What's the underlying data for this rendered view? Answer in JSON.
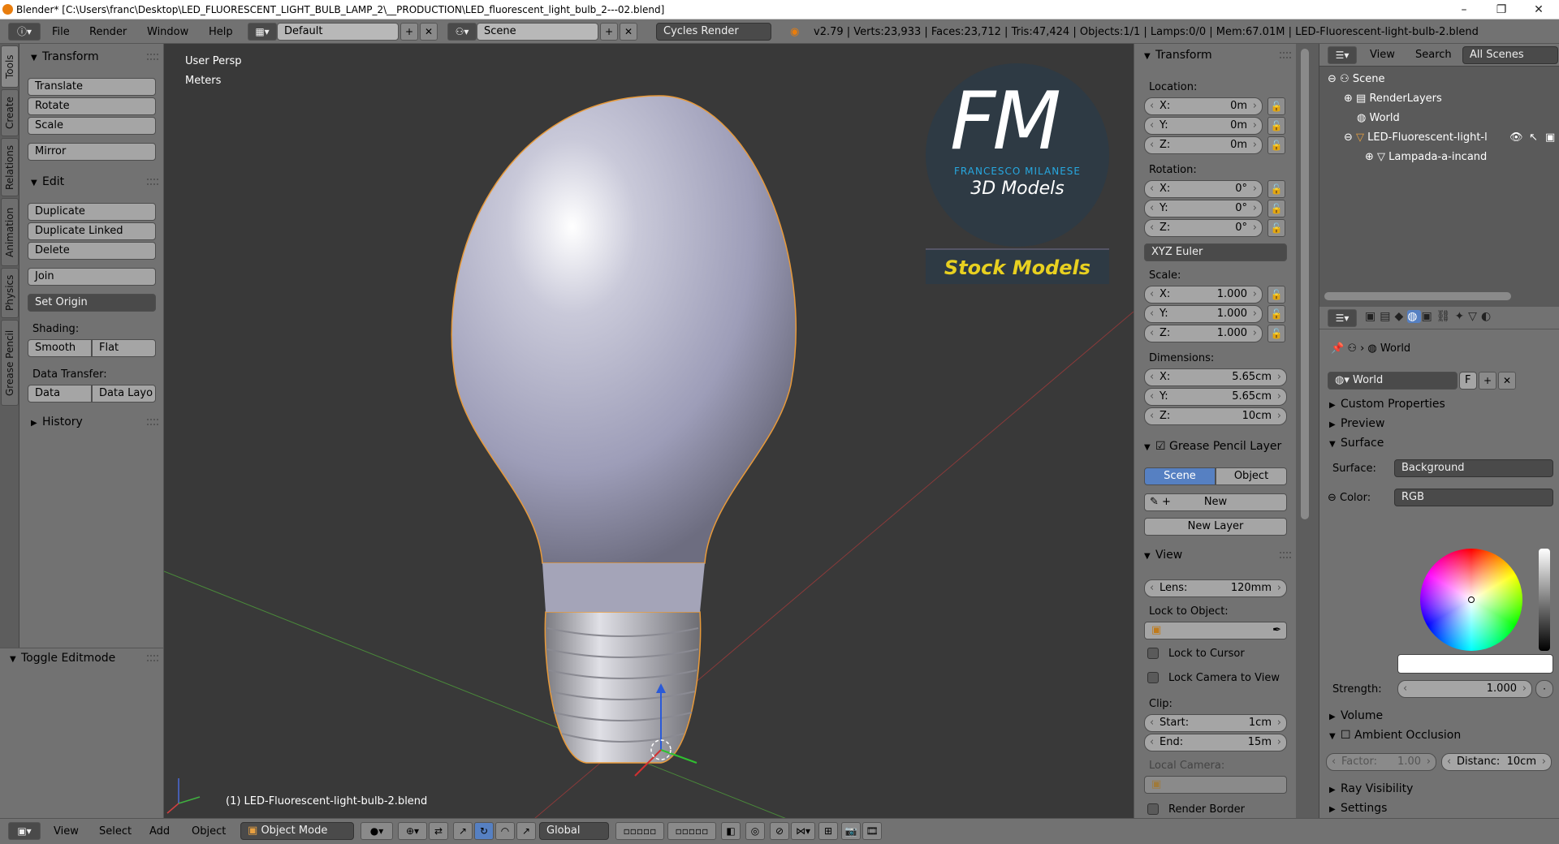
{
  "titlebar": {
    "text": "Blender* [C:\\Users\\franc\\Desktop\\LED_FLUORESCENT_LIGHT_BULB_LAMP_2\\__PRODUCTION\\LED_fluorescent_light_bulb_2---02.blend]",
    "minimize": "–",
    "maximize": "❐",
    "close": "✕"
  },
  "menu": {
    "file": "File",
    "render": "Render",
    "window": "Window",
    "help": "Help"
  },
  "layout": {
    "screen": "Default",
    "scene": "Scene",
    "engine": "Cycles Render"
  },
  "stats": "v2.79 | Verts:23,933 | Faces:23,712 | Tris:47,424 | Objects:1/1 | Lamps:0/0 | Mem:67.01M | LED-Fluorescent-light-bulb-2.blend",
  "vtabs": [
    "Tools",
    "Create",
    "Relations",
    "Animation",
    "Physics",
    "Grease Pencil"
  ],
  "tools": {
    "transform_header": "Transform",
    "translate": "Translate",
    "rotate": "Rotate",
    "scale": "Scale",
    "mirror": "Mirror",
    "edit_header": "Edit",
    "duplicate": "Duplicate",
    "duplicate_linked": "Duplicate Linked",
    "delete": "Delete",
    "join": "Join",
    "set_origin": "Set Origin",
    "shading_label": "Shading:",
    "smooth": "Smooth",
    "flat": "Flat",
    "data_transfer_label": "Data Transfer:",
    "data": "Data",
    "data_layo": "Data Layo",
    "history_header": "History"
  },
  "ops_panel": {
    "header": "Toggle Editmode"
  },
  "viewport": {
    "view_name": "User Persp",
    "units": "Meters",
    "object_info": "(1) LED-Fluorescent-light-bulb-2.blend",
    "logo": {
      "letters": "FM",
      "name": "FRANCESCO MILANESE",
      "tag": "3D Models",
      "banner": "Stock Models"
    }
  },
  "npanel": {
    "transform_header": "Transform",
    "location_label": "Location:",
    "location": {
      "x": "0m",
      "y": "0m",
      "z": "0m"
    },
    "rotation_label": "Rotation:",
    "rotation": {
      "x": "0°",
      "y": "0°",
      "z": "0°"
    },
    "rotation_mode": "XYZ Euler",
    "scale_label": "Scale:",
    "scale": {
      "x": "1.000",
      "y": "1.000",
      "z": "1.000"
    },
    "dimensions_label": "Dimensions:",
    "dimensions": {
      "x": "5.65cm",
      "y": "5.65cm",
      "z": "10cm"
    },
    "axis": {
      "x": "X:",
      "y": "Y:",
      "z": "Z:"
    },
    "gp_header": "Grease Pencil Layer",
    "gp_scene": "Scene",
    "gp_object": "Object",
    "gp_new": "New",
    "gp_new_layer": "New Layer",
    "view_header": "View",
    "lens_label": "Lens:",
    "lens": "120mm",
    "lock_to_object": "Lock to Object:",
    "lock_to_cursor": "Lock to Cursor",
    "lock_camera": "Lock Camera to View",
    "clip_label": "Clip:",
    "clip_start_label": "Start:",
    "clip_start": "1cm",
    "clip_end_label": "End:",
    "clip_end": "15m",
    "local_camera": "Local Camera:",
    "render_border": "Render Border"
  },
  "outliner": {
    "view": "View",
    "search": "Search",
    "filter": "All Scenes",
    "items": [
      "Scene",
      "RenderLayers",
      "World",
      "LED-Fluorescent-light-l",
      "Lampada-a-incand"
    ]
  },
  "props": {
    "breadcrumb_world": "World",
    "world_field": "World",
    "world_f": "F",
    "custom_properties": "Custom Properties",
    "preview": "Preview",
    "surface_header": "Surface",
    "surface_label": "Surface:",
    "surface_value": "Background",
    "color_label": "Color:",
    "color_value": "RGB",
    "strength_label": "Strength:",
    "strength": "1.000",
    "volume": "Volume",
    "ao_header": "Ambient Occlusion",
    "factor_label": "Factor:",
    "factor": "1.00",
    "distance_label": "Distanc:",
    "distance": "10cm",
    "ray_visibility": "Ray Visibility",
    "settings": "Settings"
  },
  "bottombar": {
    "view": "View",
    "select": "Select",
    "add": "Add",
    "object": "Object",
    "mode": "Object Mode",
    "orientation": "Global"
  }
}
